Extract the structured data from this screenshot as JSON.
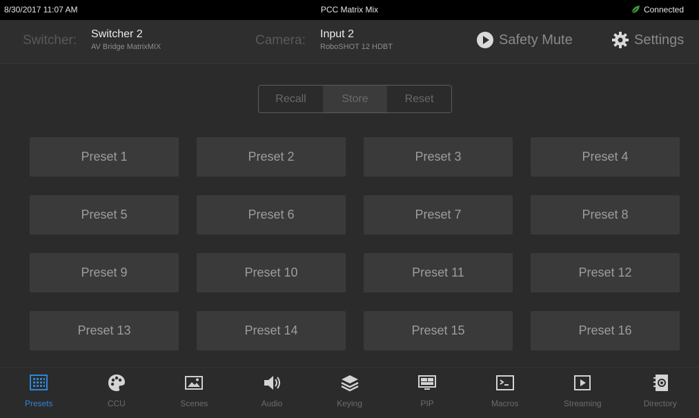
{
  "status_bar": {
    "datetime": "8/30/2017 11:07 AM",
    "title": "PCC Matrix Mix",
    "connection": "Connected",
    "connection_color": "#3fa03a"
  },
  "header": {
    "switcher_label": "Switcher:",
    "switcher_name": "Switcher 2",
    "switcher_model": "AV Bridge MatrixMIX",
    "camera_label": "Camera:",
    "camera_input": "Input 2",
    "camera_model": "RoboSHOT 12 HDBT",
    "safety_mute": "Safety Mute",
    "settings": "Settings"
  },
  "mode": {
    "options": [
      "Recall",
      "Store",
      "Reset"
    ],
    "selected": "Store"
  },
  "presets": [
    "Preset 1",
    "Preset 2",
    "Preset 3",
    "Preset 4",
    "Preset 5",
    "Preset 6",
    "Preset 7",
    "Preset 8",
    "Preset 9",
    "Preset 10",
    "Preset 11",
    "Preset 12",
    "Preset 13",
    "Preset 14",
    "Preset 15",
    "Preset 16"
  ],
  "nav": {
    "active": "Presets",
    "active_color": "#2f86d8",
    "items": [
      {
        "label": "Presets",
        "icon": "grid-icon"
      },
      {
        "label": "CCU",
        "icon": "palette-icon"
      },
      {
        "label": "Scenes",
        "icon": "image-icon"
      },
      {
        "label": "Audio",
        "icon": "speaker-icon"
      },
      {
        "label": "Keying",
        "icon": "layers-icon"
      },
      {
        "label": "PIP",
        "icon": "pip-icon"
      },
      {
        "label": "Macros",
        "icon": "terminal-icon"
      },
      {
        "label": "Streaming",
        "icon": "play-box-icon"
      },
      {
        "label": "Directory",
        "icon": "contacts-icon"
      }
    ]
  }
}
